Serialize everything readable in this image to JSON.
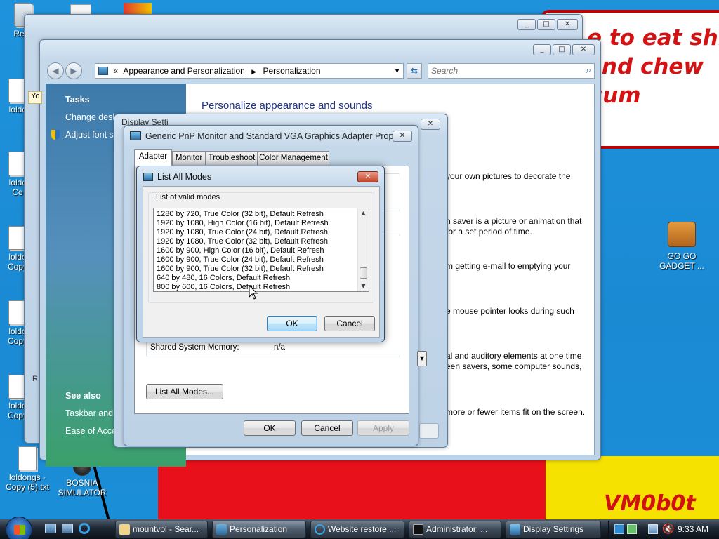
{
  "desktop": {
    "bubble_text": "e to eat shi\nand chew\ngum",
    "watermark": "VM0b0t",
    "icons": [
      {
        "label": "Recy"
      },
      {
        "label": "loldc"
      },
      {
        "label": "loldc\nCo"
      },
      {
        "label": "loldo\nCopy"
      },
      {
        "label": "loldo\nCopy"
      },
      {
        "label": "loldo\nCopy"
      },
      {
        "label": "loldongs -\nCopy (5).txt"
      },
      {
        "label": "BOSNIA\nSIMULATOR"
      },
      {
        "label": "GO GO\nGADGET ..."
      }
    ]
  },
  "control_panel": {
    "address_parts": [
      "Appearance and Personalization",
      "Personalization"
    ],
    "address_prefix": "«",
    "search_placeholder": "Search",
    "tasks_heading": "Tasks",
    "tasks": [
      "Change desk",
      "Adjust font si"
    ],
    "see_also_heading": "See also",
    "see_also": [
      "Taskbar and S",
      "Ease of Acces"
    ],
    "page_title": "Personalize appearance and sounds",
    "paragraphs": [
      "your own pictures to decorate the",
      "n saver is a picture or animation that\nfor a set period of time.",
      "m getting e-mail to emptying your",
      "e mouse pointer looks during such",
      "al and auditory elements at one time\neen savers, some computer sounds,",
      "more or fewer items fit on the screen."
    ],
    "clipped_labels": {
      "yo": "Yo",
      "r": "R"
    }
  },
  "display_settings": {
    "title_clip": "Display Setti"
  },
  "adapter_props": {
    "title": "Generic PnP Monitor and Standard VGA Graphics Adapter Prope...",
    "tabs": [
      "Adapter",
      "Monitor",
      "Troubleshoot",
      "Color Management"
    ],
    "shared_memory_label": "Shared System Memory:",
    "shared_memory_value": "n/a",
    "list_all_modes_button": "List All Modes...",
    "ok": "OK",
    "cancel": "Cancel",
    "apply": "Apply"
  },
  "modes_dialog": {
    "title": "List All Modes",
    "group_label": "List of valid modes",
    "modes": [
      "1280 by 720, True Color (32 bit), Default Refresh",
      "1920 by 1080, High Color (16 bit), Default Refresh",
      "1920 by 1080, True Color (24 bit), Default Refresh",
      "1920 by 1080, True Color (32 bit), Default Refresh",
      "1600 by 900, High Color (16 bit), Default Refresh",
      "1600 by 900, True Color (24 bit), Default Refresh",
      "1600 by 900, True Color (32 bit), Default Refresh",
      "640 by 480, 16 Colors, Default Refresh",
      "800 by 600, 16 Colors, Default Refresh"
    ],
    "ok": "OK",
    "cancel": "Cancel"
  },
  "taskbar": {
    "items": [
      {
        "label": "mountvol - Sear..."
      },
      {
        "label": "Personalization"
      },
      {
        "label": "Website restore ..."
      },
      {
        "label": "Administrator: ..."
      },
      {
        "label": "Display Settings"
      }
    ],
    "clock": "9:33 AM"
  },
  "colors": {
    "wallpaper_blue": "#1a8ad3",
    "bubble_red": "#d31313",
    "shape_red": "#e8101a",
    "shape_yellow": "#f5e200",
    "sidebar_blue": "#3d7aaa",
    "sidebar_green": "#3aa06a"
  }
}
